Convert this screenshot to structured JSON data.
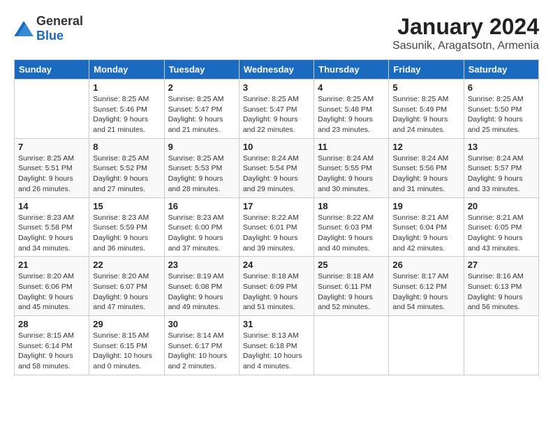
{
  "header": {
    "logo_general": "General",
    "logo_blue": "Blue",
    "month_title": "January 2024",
    "location": "Sasunik, Aragatsotn, Armenia"
  },
  "days_of_week": [
    "Sunday",
    "Monday",
    "Tuesday",
    "Wednesday",
    "Thursday",
    "Friday",
    "Saturday"
  ],
  "weeks": [
    [
      {
        "day": "",
        "sunrise": "",
        "sunset": "",
        "daylight": ""
      },
      {
        "day": "1",
        "sunrise": "Sunrise: 8:25 AM",
        "sunset": "Sunset: 5:46 PM",
        "daylight": "Daylight: 9 hours and 21 minutes."
      },
      {
        "day": "2",
        "sunrise": "Sunrise: 8:25 AM",
        "sunset": "Sunset: 5:47 PM",
        "daylight": "Daylight: 9 hours and 21 minutes."
      },
      {
        "day": "3",
        "sunrise": "Sunrise: 8:25 AM",
        "sunset": "Sunset: 5:47 PM",
        "daylight": "Daylight: 9 hours and 22 minutes."
      },
      {
        "day": "4",
        "sunrise": "Sunrise: 8:25 AM",
        "sunset": "Sunset: 5:48 PM",
        "daylight": "Daylight: 9 hours and 23 minutes."
      },
      {
        "day": "5",
        "sunrise": "Sunrise: 8:25 AM",
        "sunset": "Sunset: 5:49 PM",
        "daylight": "Daylight: 9 hours and 24 minutes."
      },
      {
        "day": "6",
        "sunrise": "Sunrise: 8:25 AM",
        "sunset": "Sunset: 5:50 PM",
        "daylight": "Daylight: 9 hours and 25 minutes."
      }
    ],
    [
      {
        "day": "7",
        "sunrise": "Sunrise: 8:25 AM",
        "sunset": "Sunset: 5:51 PM",
        "daylight": "Daylight: 9 hours and 26 minutes."
      },
      {
        "day": "8",
        "sunrise": "Sunrise: 8:25 AM",
        "sunset": "Sunset: 5:52 PM",
        "daylight": "Daylight: 9 hours and 27 minutes."
      },
      {
        "day": "9",
        "sunrise": "Sunrise: 8:25 AM",
        "sunset": "Sunset: 5:53 PM",
        "daylight": "Daylight: 9 hours and 28 minutes."
      },
      {
        "day": "10",
        "sunrise": "Sunrise: 8:24 AM",
        "sunset": "Sunset: 5:54 PM",
        "daylight": "Daylight: 9 hours and 29 minutes."
      },
      {
        "day": "11",
        "sunrise": "Sunrise: 8:24 AM",
        "sunset": "Sunset: 5:55 PM",
        "daylight": "Daylight: 9 hours and 30 minutes."
      },
      {
        "day": "12",
        "sunrise": "Sunrise: 8:24 AM",
        "sunset": "Sunset: 5:56 PM",
        "daylight": "Daylight: 9 hours and 31 minutes."
      },
      {
        "day": "13",
        "sunrise": "Sunrise: 8:24 AM",
        "sunset": "Sunset: 5:57 PM",
        "daylight": "Daylight: 9 hours and 33 minutes."
      }
    ],
    [
      {
        "day": "14",
        "sunrise": "Sunrise: 8:23 AM",
        "sunset": "Sunset: 5:58 PM",
        "daylight": "Daylight: 9 hours and 34 minutes."
      },
      {
        "day": "15",
        "sunrise": "Sunrise: 8:23 AM",
        "sunset": "Sunset: 5:59 PM",
        "daylight": "Daylight: 9 hours and 36 minutes."
      },
      {
        "day": "16",
        "sunrise": "Sunrise: 8:23 AM",
        "sunset": "Sunset: 6:00 PM",
        "daylight": "Daylight: 9 hours and 37 minutes."
      },
      {
        "day": "17",
        "sunrise": "Sunrise: 8:22 AM",
        "sunset": "Sunset: 6:01 PM",
        "daylight": "Daylight: 9 hours and 39 minutes."
      },
      {
        "day": "18",
        "sunrise": "Sunrise: 8:22 AM",
        "sunset": "Sunset: 6:03 PM",
        "daylight": "Daylight: 9 hours and 40 minutes."
      },
      {
        "day": "19",
        "sunrise": "Sunrise: 8:21 AM",
        "sunset": "Sunset: 6:04 PM",
        "daylight": "Daylight: 9 hours and 42 minutes."
      },
      {
        "day": "20",
        "sunrise": "Sunrise: 8:21 AM",
        "sunset": "Sunset: 6:05 PM",
        "daylight": "Daylight: 9 hours and 43 minutes."
      }
    ],
    [
      {
        "day": "21",
        "sunrise": "Sunrise: 8:20 AM",
        "sunset": "Sunset: 6:06 PM",
        "daylight": "Daylight: 9 hours and 45 minutes."
      },
      {
        "day": "22",
        "sunrise": "Sunrise: 8:20 AM",
        "sunset": "Sunset: 6:07 PM",
        "daylight": "Daylight: 9 hours and 47 minutes."
      },
      {
        "day": "23",
        "sunrise": "Sunrise: 8:19 AM",
        "sunset": "Sunset: 6:08 PM",
        "daylight": "Daylight: 9 hours and 49 minutes."
      },
      {
        "day": "24",
        "sunrise": "Sunrise: 8:18 AM",
        "sunset": "Sunset: 6:09 PM",
        "daylight": "Daylight: 9 hours and 51 minutes."
      },
      {
        "day": "25",
        "sunrise": "Sunrise: 8:18 AM",
        "sunset": "Sunset: 6:11 PM",
        "daylight": "Daylight: 9 hours and 52 minutes."
      },
      {
        "day": "26",
        "sunrise": "Sunrise: 8:17 AM",
        "sunset": "Sunset: 6:12 PM",
        "daylight": "Daylight: 9 hours and 54 minutes."
      },
      {
        "day": "27",
        "sunrise": "Sunrise: 8:16 AM",
        "sunset": "Sunset: 6:13 PM",
        "daylight": "Daylight: 9 hours and 56 minutes."
      }
    ],
    [
      {
        "day": "28",
        "sunrise": "Sunrise: 8:15 AM",
        "sunset": "Sunset: 6:14 PM",
        "daylight": "Daylight: 9 hours and 58 minutes."
      },
      {
        "day": "29",
        "sunrise": "Sunrise: 8:15 AM",
        "sunset": "Sunset: 6:15 PM",
        "daylight": "Daylight: 10 hours and 0 minutes."
      },
      {
        "day": "30",
        "sunrise": "Sunrise: 8:14 AM",
        "sunset": "Sunset: 6:17 PM",
        "daylight": "Daylight: 10 hours and 2 minutes."
      },
      {
        "day": "31",
        "sunrise": "Sunrise: 8:13 AM",
        "sunset": "Sunset: 6:18 PM",
        "daylight": "Daylight: 10 hours and 4 minutes."
      },
      {
        "day": "",
        "sunrise": "",
        "sunset": "",
        "daylight": ""
      },
      {
        "day": "",
        "sunrise": "",
        "sunset": "",
        "daylight": ""
      },
      {
        "day": "",
        "sunrise": "",
        "sunset": "",
        "daylight": ""
      }
    ]
  ]
}
